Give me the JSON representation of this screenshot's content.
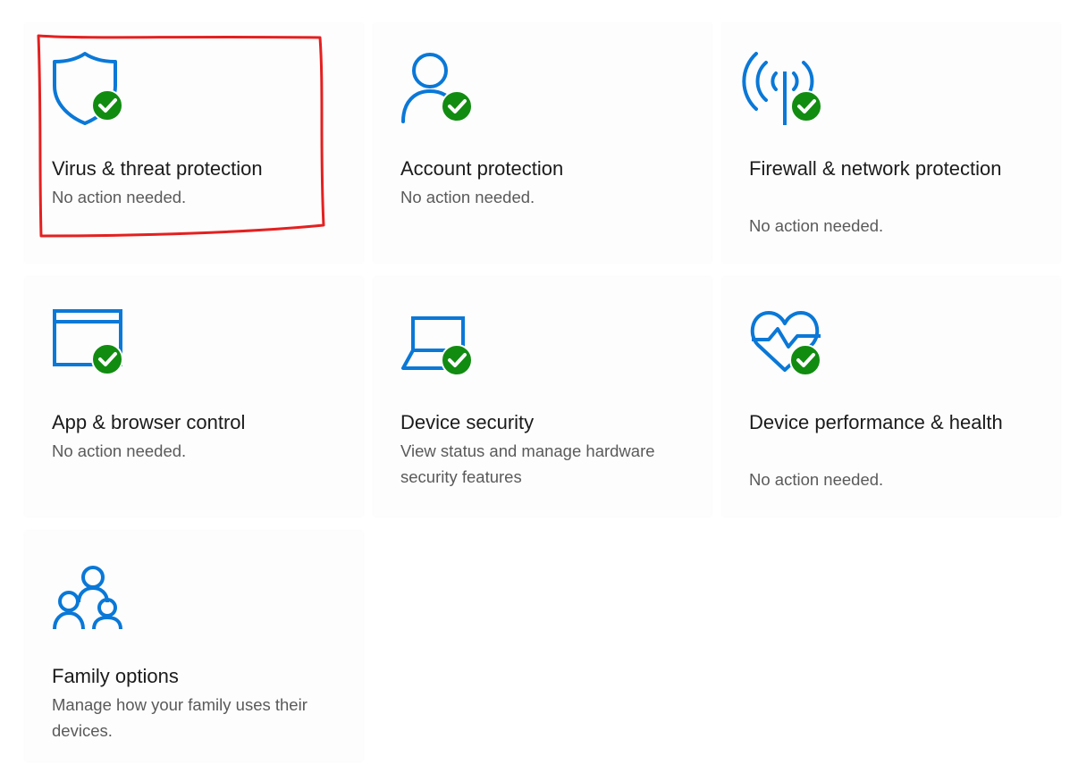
{
  "colors": {
    "accent": "#0a78d7",
    "ok_badge": "#118c11",
    "annotation": "#e42020"
  },
  "tiles": [
    {
      "title": "Virus & threat protection",
      "status": "No action needed.",
      "icon": "shield-icon",
      "badge": "check-badge-icon"
    },
    {
      "title": "Account protection",
      "status": "No action needed.",
      "icon": "person-icon",
      "badge": "check-badge-icon"
    },
    {
      "title": "Firewall & network protection",
      "status": "No action needed.",
      "icon": "antenna-icon",
      "badge": "check-badge-icon"
    },
    {
      "title": "App & browser control",
      "status": "No action needed.",
      "icon": "browser-window-icon",
      "badge": "check-badge-icon"
    },
    {
      "title": "Device security",
      "status": "View status and manage hardware security features",
      "icon": "laptop-icon",
      "badge": "check-badge-icon"
    },
    {
      "title": "Device performance & health",
      "status": "No action needed.",
      "icon": "heart-pulse-icon",
      "badge": "check-badge-icon"
    },
    {
      "title": "Family options",
      "status": "Manage how your family uses their devices.",
      "icon": "family-icon"
    }
  ]
}
